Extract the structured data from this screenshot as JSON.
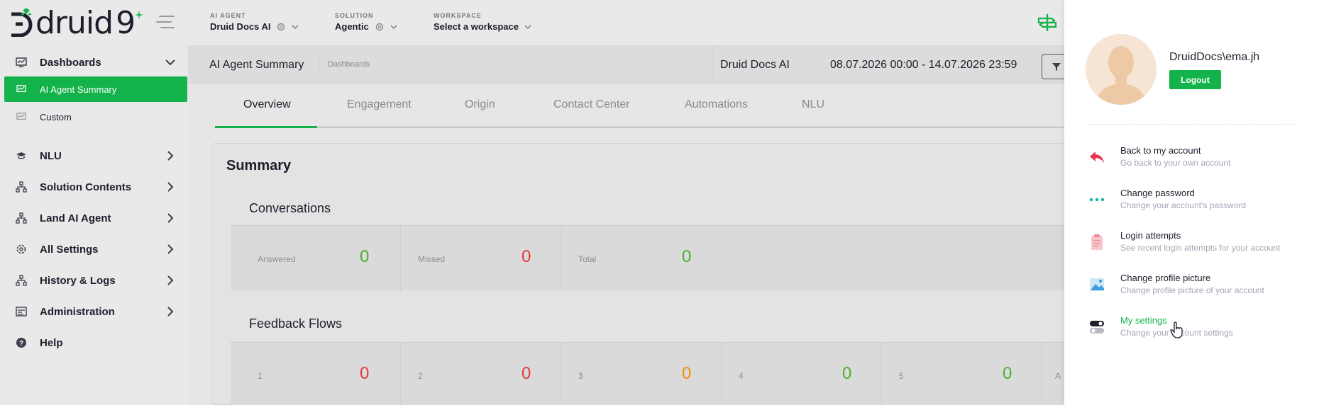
{
  "brand": {
    "logo_text": "druid",
    "logo_suffix": "9",
    "accent": "#13b24a"
  },
  "topbar": {
    "ai_agent": {
      "caption": "AI AGENT",
      "value": "Druid Docs AI"
    },
    "solution": {
      "caption": "SOLUTION",
      "value": "Agentic"
    },
    "workspace": {
      "caption": "WORKSPACE",
      "value": "Select a workspace"
    }
  },
  "sidebar": {
    "items": [
      {
        "label": "Dashboards",
        "icon": "dashboard-icon",
        "expanded": true
      },
      {
        "label": "AI Agent Summary",
        "icon": "dashboard-icon",
        "active": true
      },
      {
        "label": "Custom",
        "icon": "dashboard-icon"
      },
      {
        "label": "NLU",
        "icon": "graduation-cap-icon"
      },
      {
        "label": "Solution Contents",
        "icon": "sitemap-icon"
      },
      {
        "label": "Land AI Agent",
        "icon": "sitemap-icon"
      },
      {
        "label": "All Settings",
        "icon": "gear-icon"
      },
      {
        "label": "History & Logs",
        "icon": "sitemap-icon"
      },
      {
        "label": "Administration",
        "icon": "admin-icon"
      },
      {
        "label": "Help",
        "icon": "help-icon"
      }
    ]
  },
  "header": {
    "title": "AI Agent Summary",
    "breadcrumb": "Dashboards",
    "agent": "Druid Docs AI",
    "date_range": "08.07.2026 00:00 - 14.07.2026 23:59"
  },
  "tabs": [
    {
      "label": "Overview",
      "active": true
    },
    {
      "label": "Engagement"
    },
    {
      "label": "Origin"
    },
    {
      "label": "Contact Center"
    },
    {
      "label": "Automations"
    },
    {
      "label": "NLU"
    }
  ],
  "summary": {
    "title": "Summary",
    "conversations": {
      "title": "Conversations",
      "metrics": [
        {
          "label": "Answered",
          "value": "0",
          "color": "#4caf2a"
        },
        {
          "label": "Missed",
          "value": "0",
          "color": "#e53935"
        },
        {
          "label": "Total",
          "value": "0",
          "color": "#4caf2a"
        }
      ]
    },
    "feedback": {
      "title": "Feedback Flows",
      "metrics": [
        {
          "label": "1",
          "value": "0",
          "color": "#e53935"
        },
        {
          "label": "2",
          "value": "0",
          "color": "#e53935"
        },
        {
          "label": "3",
          "value": "0",
          "color": "#f29100"
        },
        {
          "label": "4",
          "value": "0",
          "color": "#4caf2a"
        },
        {
          "label": "5",
          "value": "0",
          "color": "#4caf2a"
        },
        {
          "label": "A",
          "value": "",
          "color": "#8d8d8d"
        }
      ]
    }
  },
  "account_panel": {
    "username": "DruidDocs\\ema.jh",
    "logout_label": "Logout",
    "items": [
      {
        "title": "Back to my account",
        "desc": "Go back to your own account",
        "icon": "reply-arrow-icon"
      },
      {
        "title": "Change password",
        "desc": "Change your account's password",
        "icon": "dots-icon"
      },
      {
        "title": "Login attempts",
        "desc": "See recent login attempts for your account",
        "icon": "clipboard-icon"
      },
      {
        "title": "Change profile picture",
        "desc": "Change profile picture of your account",
        "icon": "image-icon"
      },
      {
        "title": "My settings",
        "desc": "Change your account settings",
        "icon": "toggle-icon",
        "hovered": true
      }
    ]
  }
}
